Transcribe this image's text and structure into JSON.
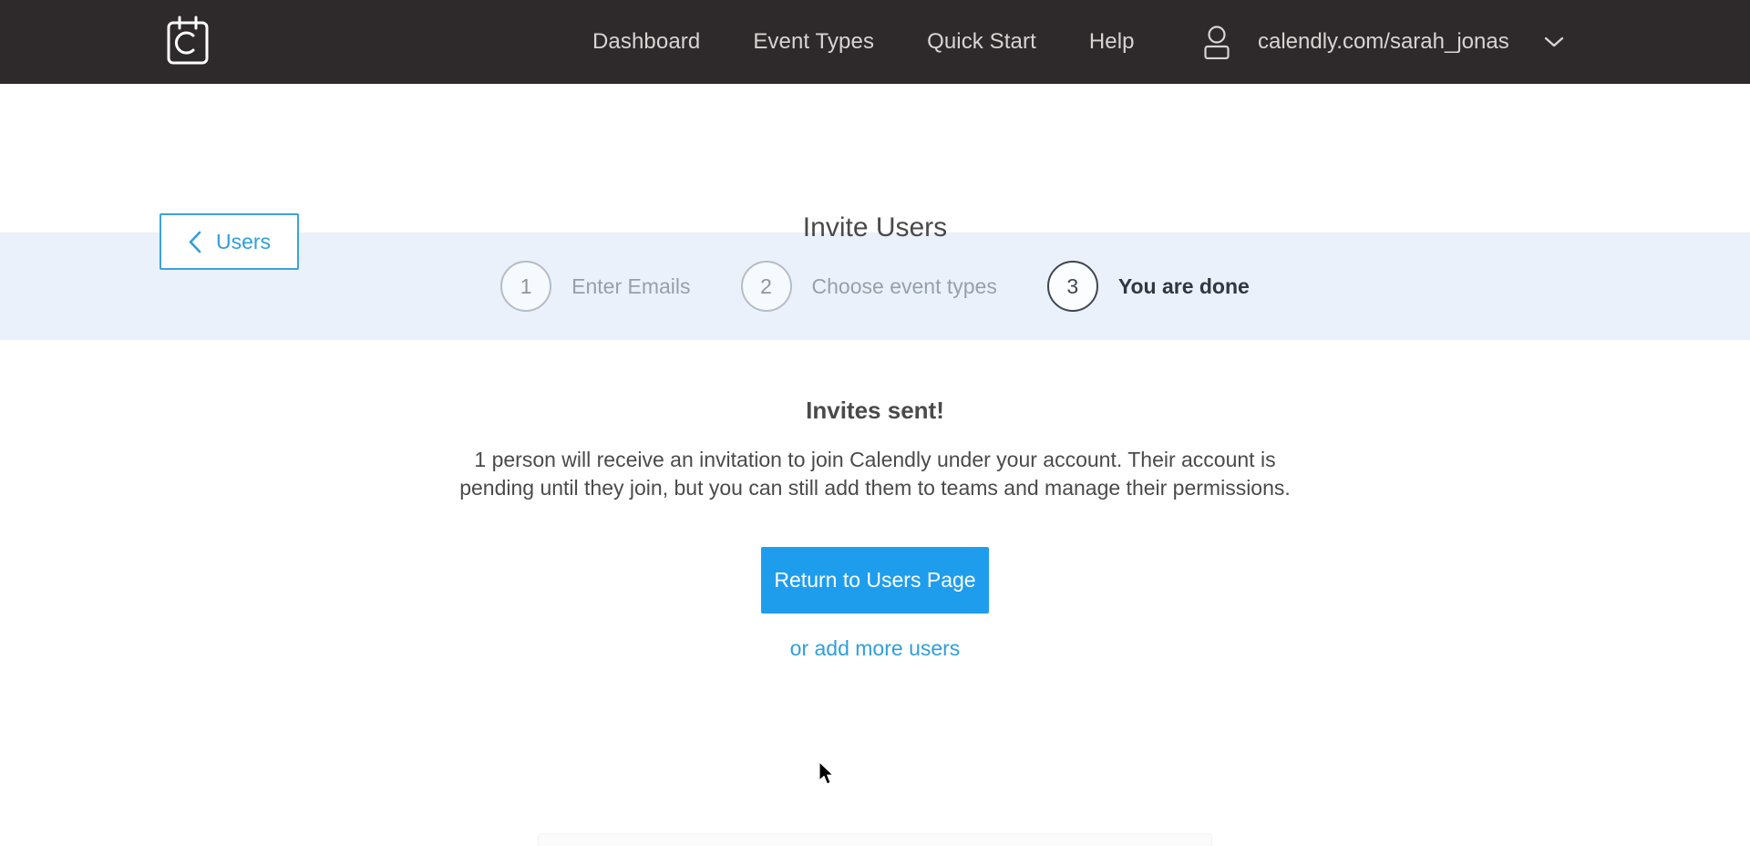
{
  "topbar": {
    "logo": {
      "icon": "calendly-calendar-logo-icon",
      "letter": "C"
    },
    "nav": [
      {
        "label": "Dashboard"
      },
      {
        "label": "Event Types"
      },
      {
        "label": "Quick Start"
      },
      {
        "label": "Help"
      }
    ],
    "account": {
      "icon": "user-icon",
      "url": "calendly.com/sarah_jonas",
      "chevron": "chevron-down-icon"
    },
    "background_color": "#2e2a2b",
    "text_color": "#d9d4d4"
  },
  "page_header": {
    "back_button": {
      "label": "Users",
      "icon": "chevron-left-icon"
    },
    "title": "Invite Users"
  },
  "stepper": {
    "background_color": "#eaf1fa",
    "steps": [
      {
        "number": "1",
        "label": "Enter Emails",
        "state": "inactive"
      },
      {
        "number": "2",
        "label": "Choose event types",
        "state": "inactive"
      },
      {
        "number": "3",
        "label": "You are done",
        "state": "active"
      }
    ]
  },
  "main": {
    "heading": "Invites sent!",
    "body": "1 person will receive an invitation to join Calendly under your account. Their account is pending until they join, but you can still add them to teams and manage their permissions.",
    "primary_button": {
      "label": "Return to Users Page",
      "color": "#1f9ded"
    },
    "secondary_link": {
      "label": "or add more users",
      "color": "#2f9fdb"
    }
  }
}
